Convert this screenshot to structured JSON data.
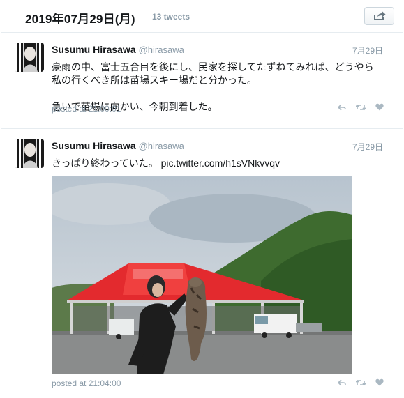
{
  "header": {
    "date": "2019年07月29日(月)",
    "count": "13 tweets",
    "share_icon": "share-icon"
  },
  "tweets": [
    {
      "name": "Susumu Hirasawa",
      "handle": "@hirasawa",
      "time": "7月29日",
      "text": "豪雨の中、富士五合目を後にし、民家を探してたずねてみれば、どうやら私の行くべき所は苗場スキー場だと分かった。\n\n急いで苗場に向かい、今朝到着した。",
      "posted": "posted at 21:00:01"
    },
    {
      "name": "Susumu Hirasawa",
      "handle": "@hirasawa",
      "time": "7月29日",
      "text": "きっぱり終わっていた。 pic.twitter.com/h1sVNkvvqv",
      "posted": "posted at 21:04:00"
    }
  ],
  "icons": {
    "reply": "reply-icon",
    "retweet": "retweet-icon",
    "like": "heart-icon"
  },
  "colors": {
    "muted": "#8899a6",
    "text": "#14171a",
    "tent_red": "#e32a2e"
  }
}
